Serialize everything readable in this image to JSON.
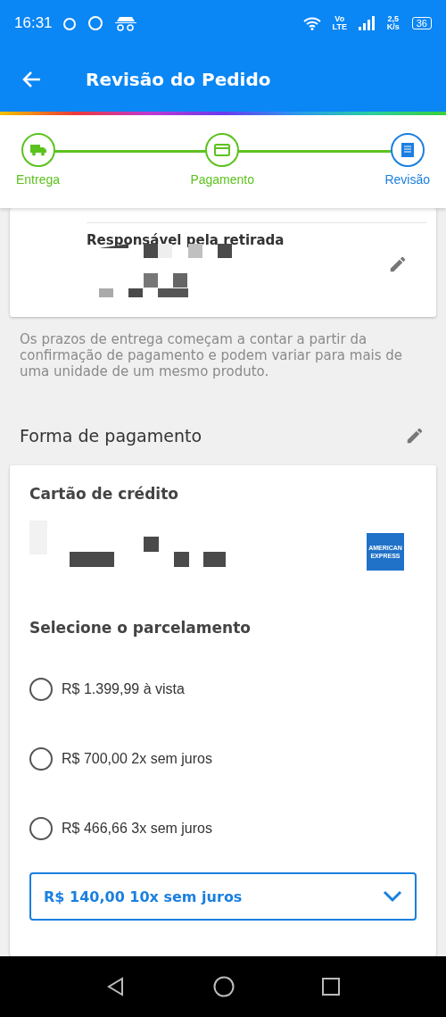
{
  "status_bar": {
    "time": "16:31",
    "network": "Vo LTE",
    "speed": "2,5 K/s",
    "battery": "36"
  },
  "app_bar": {
    "title": "Revisão do Pedido"
  },
  "stepper": [
    {
      "label": "Entrega",
      "kind": "truck",
      "done": true,
      "selected": false
    },
    {
      "label": "Pagamento",
      "kind": "card",
      "done": true,
      "selected": false
    },
    {
      "label": "Revisão",
      "kind": "receipt",
      "selected": true
    }
  ],
  "pickup_card": {
    "label": "Responsável pela retirada"
  },
  "delivery_note": "Os prazos de entrega começam a contar a partir da confirmação de pagamento e podem variar para mais de uma unidade de um mesmo produto.",
  "payment": {
    "heading": "Forma de pagamento",
    "method": "Cartão de crédito",
    "card_brand": "AMERICAN EXPRESS",
    "installments_heading": "Selecione o parcelamento",
    "options": [
      {
        "label": "R$ 1.399,99 à vista",
        "selected": false
      },
      {
        "label": "R$ 700,00 2x sem juros",
        "selected": false
      },
      {
        "label": "R$ 466,66 3x sem juros",
        "selected": false
      }
    ],
    "dropdown": {
      "value": "R$ 140,00 10x sem juros"
    }
  }
}
